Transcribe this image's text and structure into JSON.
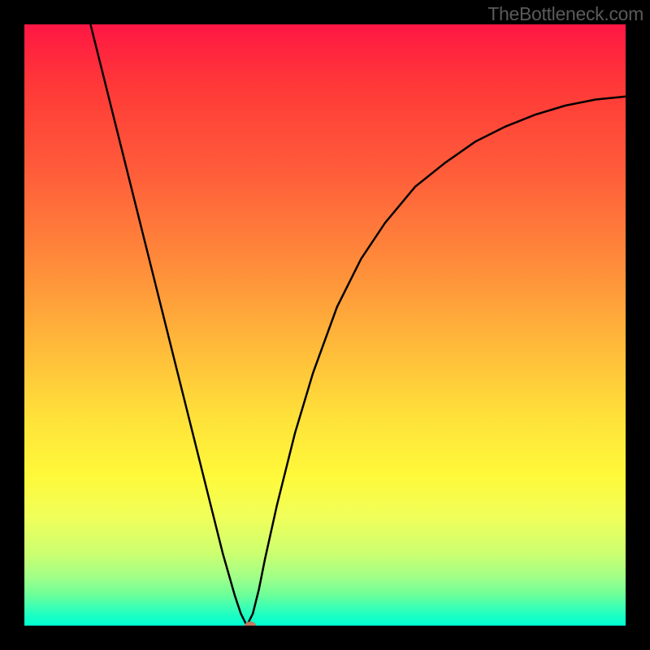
{
  "watermark": "TheBottleneck.com",
  "chart_data": {
    "type": "line",
    "title": "",
    "xlabel": "",
    "ylabel": "",
    "xlim": [
      0,
      100
    ],
    "ylim": [
      0,
      100
    ],
    "series": [
      {
        "name": "bottleneck-curve",
        "x": [
          11,
          13,
          15,
          17,
          19,
          21,
          23,
          25,
          27,
          29,
          31,
          33,
          35,
          36,
          37,
          38,
          39,
          40,
          42,
          45,
          48,
          52,
          56,
          60,
          65,
          70,
          75,
          80,
          85,
          90,
          95,
          100
        ],
        "values": [
          100,
          92,
          84,
          76,
          68,
          60,
          52,
          44,
          36,
          28,
          20,
          12,
          5,
          2,
          0,
          2,
          6,
          11,
          20,
          32,
          42,
          53,
          61,
          67,
          73,
          77,
          80.5,
          83,
          85,
          86.5,
          87.5,
          88
        ]
      }
    ],
    "marker": {
      "x": 37.5,
      "y": 0
    },
    "gradient_stops": [
      {
        "pos": 0,
        "color": "#ff1744"
      },
      {
        "pos": 50,
        "color": "#ffd93a"
      },
      {
        "pos": 100,
        "color": "#00ffd2"
      }
    ]
  }
}
